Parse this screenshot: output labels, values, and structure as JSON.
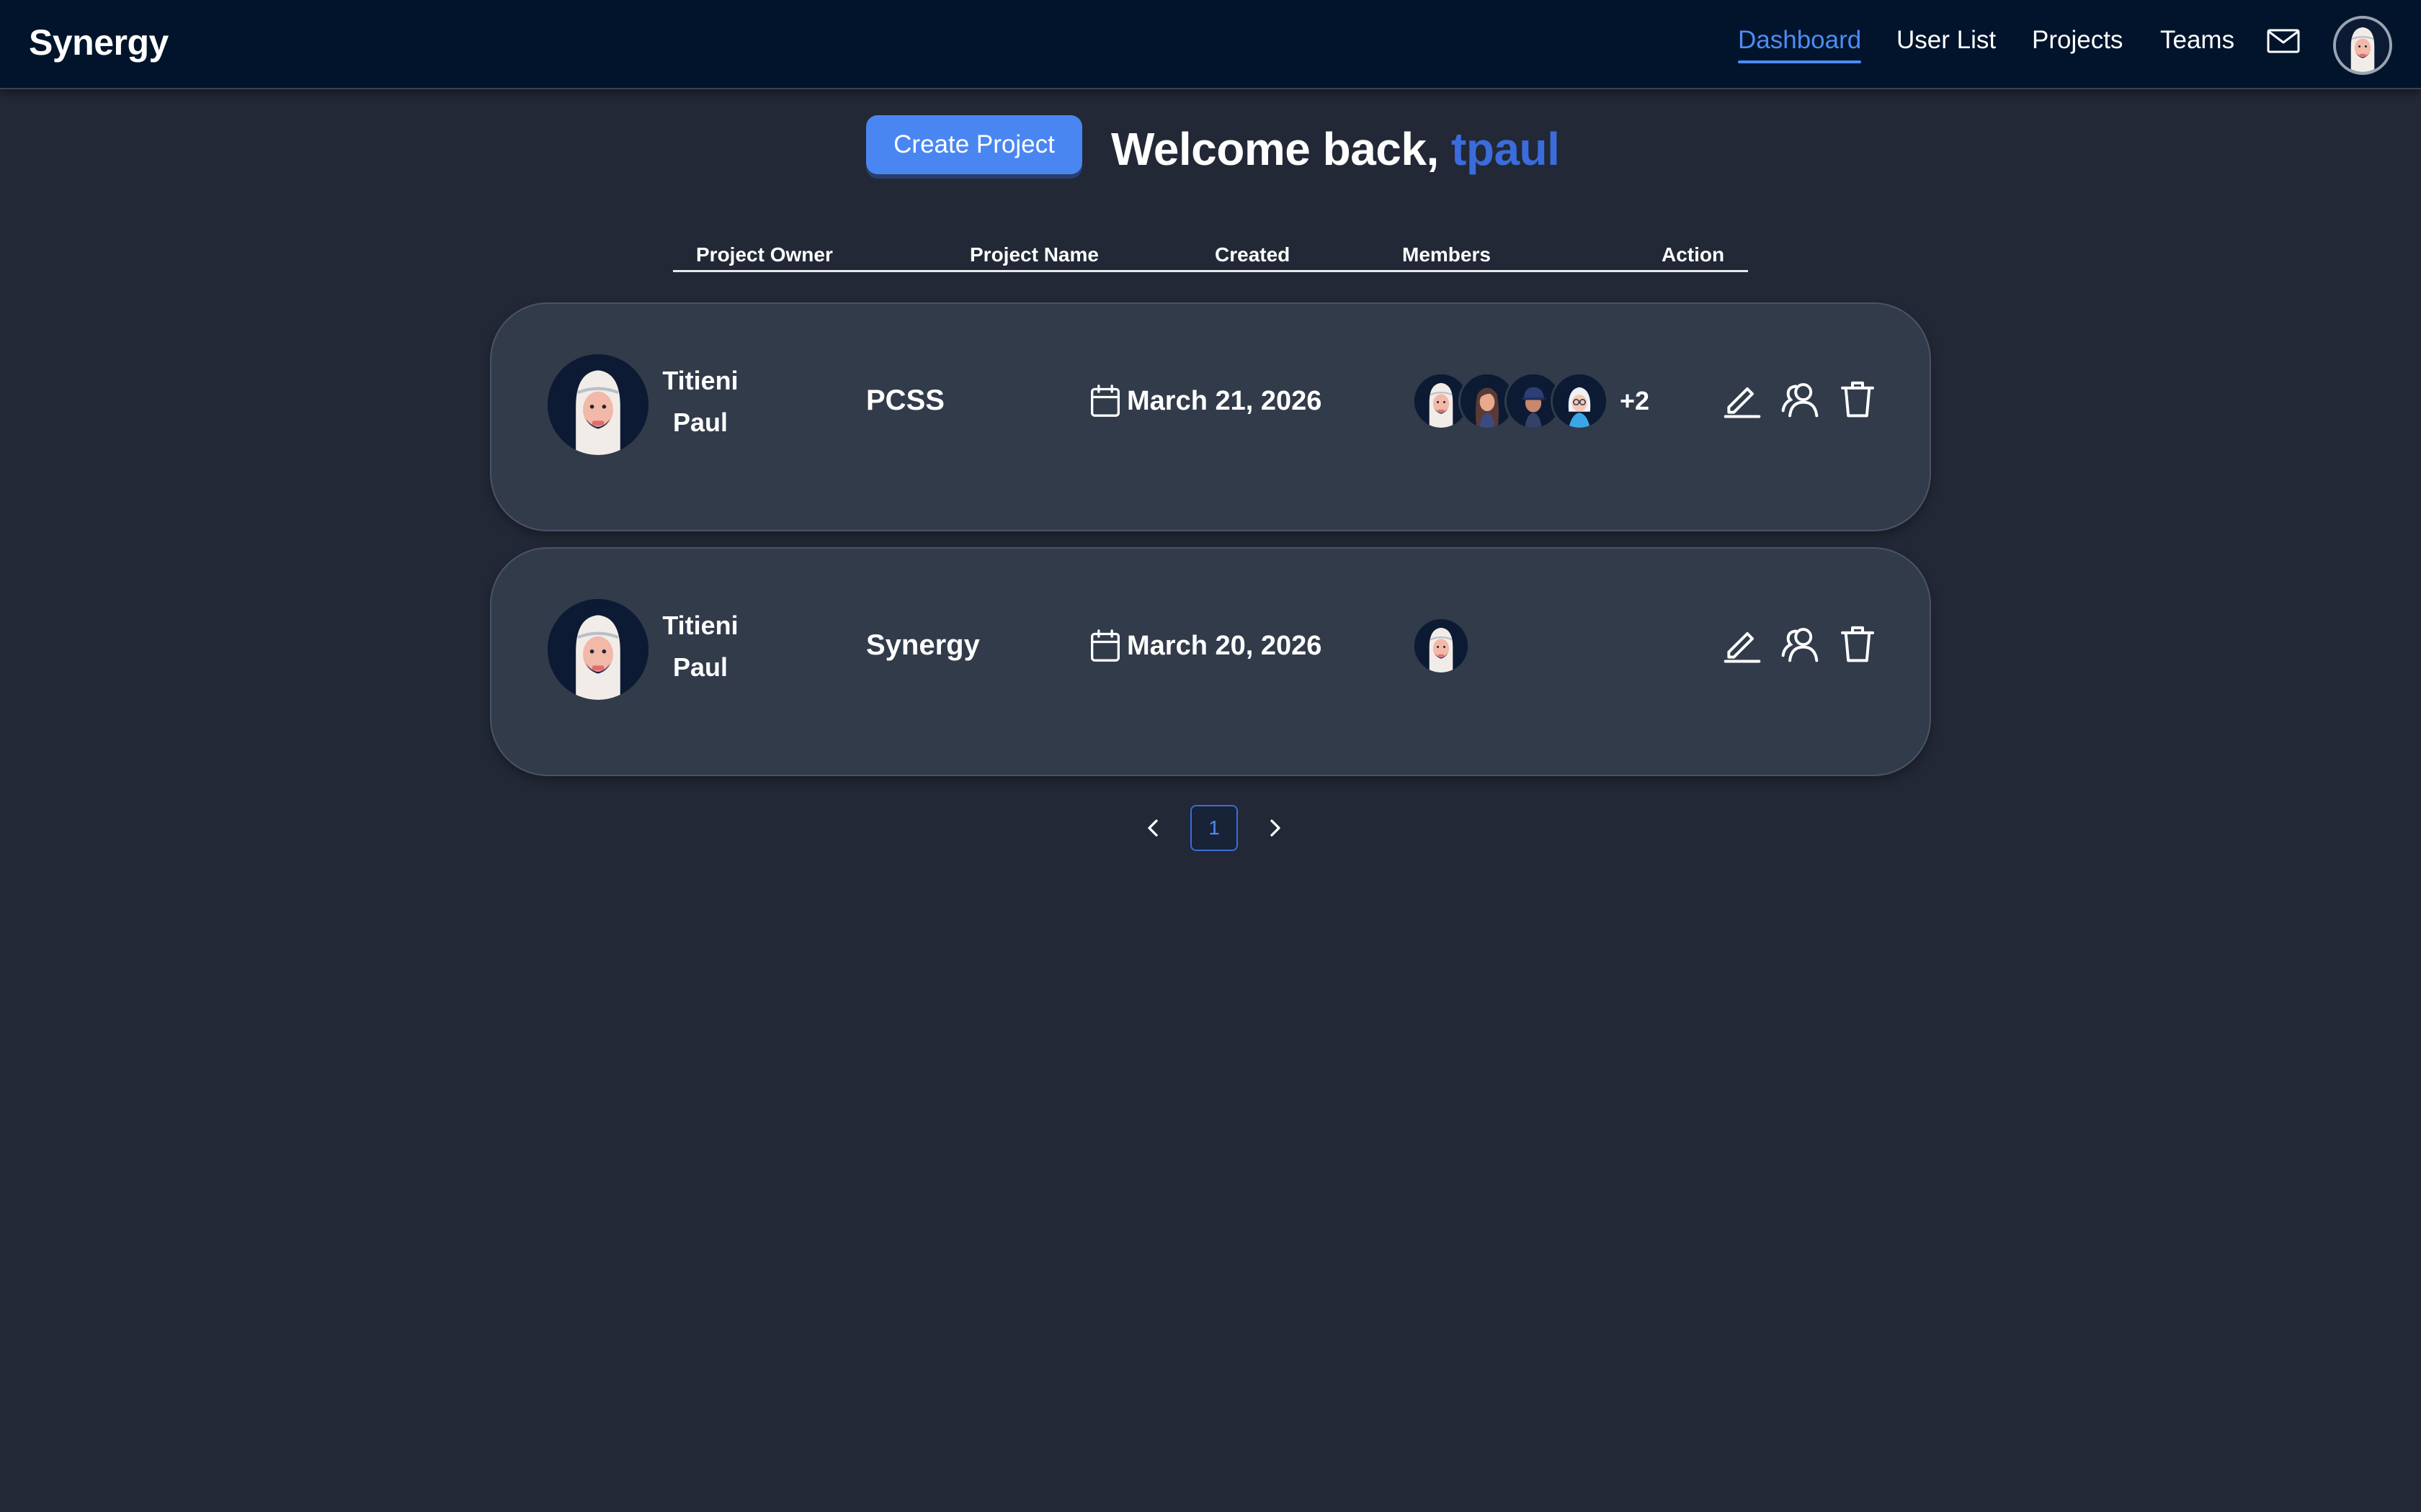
{
  "app": {
    "brand": "Synergy"
  },
  "nav": {
    "items": [
      "Dashboard",
      "User List",
      "Projects",
      "Teams"
    ],
    "active": "Dashboard"
  },
  "header": {
    "create_label": "Create Project",
    "welcome_prefix": "Welcome back, ",
    "username": "tpaul"
  },
  "table": {
    "columns": [
      "Project Owner",
      "Project Name",
      "Created",
      "Members",
      "Action"
    ],
    "rows": [
      {
        "owner_first": "Titieni",
        "owner_last": "Paul",
        "project": "PCSS",
        "created": "March 21, 2026",
        "member_avatars": [
          "avatar-headscarf",
          "avatar-long-hair",
          "avatar-cap",
          "avatar-white-hair"
        ],
        "more_members": "+2"
      },
      {
        "owner_first": "Titieni",
        "owner_last": "Paul",
        "project": "Synergy",
        "created": "March 20, 2026",
        "member_avatars": [
          "avatar-headscarf"
        ],
        "more_members": ""
      }
    ]
  },
  "pagination": {
    "current": "1"
  },
  "icons": {
    "mail": "mail-icon",
    "calendar": "calendar-icon",
    "edit": "pencil-icon",
    "members": "users-icon",
    "delete": "trash-icon",
    "prev": "chevron-left-icon",
    "next": "chevron-right-icon"
  },
  "colors": {
    "background": "#222835",
    "navbar": "#01142b",
    "card": "#323b4a",
    "accent": "#4a86f2",
    "username": "#3a6cdc"
  }
}
